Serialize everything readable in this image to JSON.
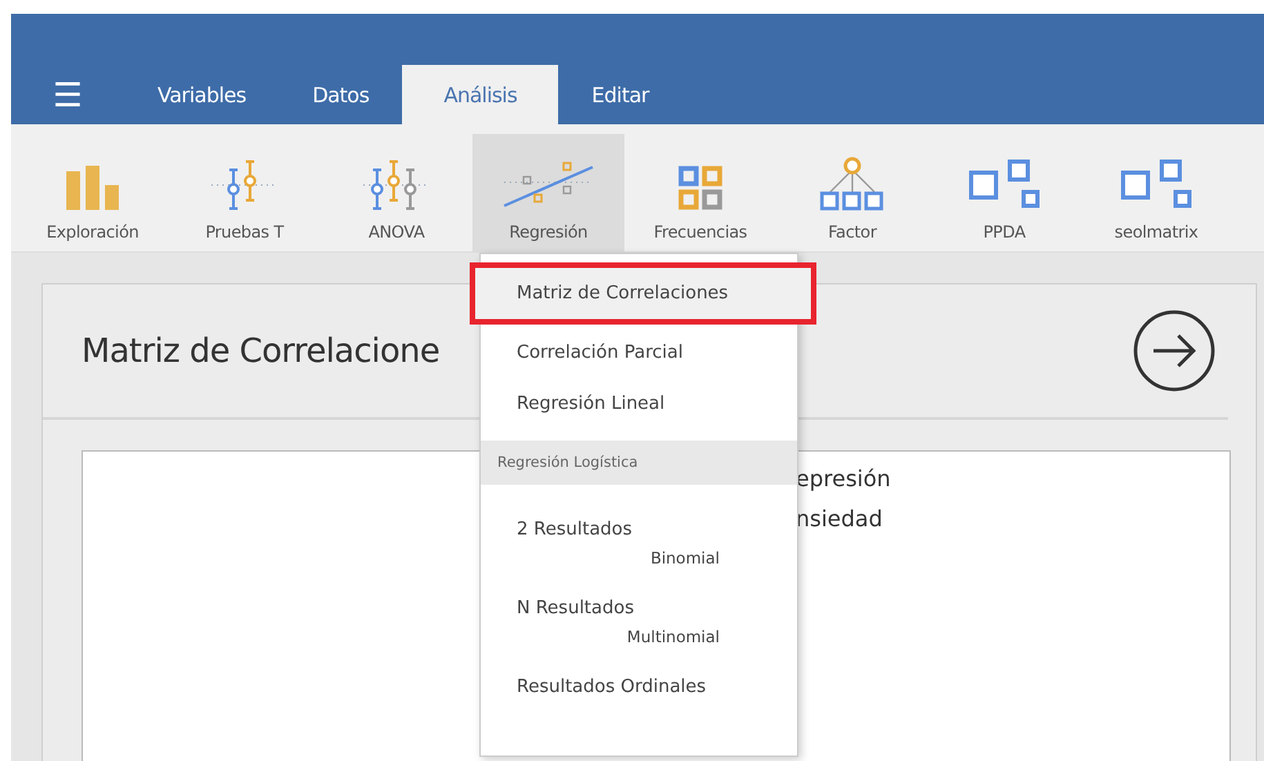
{
  "menu_icon": "☰",
  "tabs": [
    {
      "label": "Variables",
      "selected": false
    },
    {
      "label": "Datos",
      "selected": false
    },
    {
      "label": "Análisis",
      "selected": true
    },
    {
      "label": "Editar",
      "selected": false
    }
  ],
  "ribbon": [
    {
      "label": "Exploración",
      "kind": "bars",
      "selected": false
    },
    {
      "label": "Pruebas T",
      "kind": "ttest",
      "selected": false
    },
    {
      "label": "ANOVA",
      "kind": "anova",
      "selected": false
    },
    {
      "label": "Regresión",
      "kind": "regression",
      "selected": true
    },
    {
      "label": "Frecuencias",
      "kind": "grid",
      "selected": false
    },
    {
      "label": "Factor",
      "kind": "tree",
      "selected": false
    },
    {
      "label": "PPDA",
      "kind": "boxes",
      "selected": false
    },
    {
      "label": "seolmatrix",
      "kind": "boxes",
      "selected": false
    }
  ],
  "panel": {
    "title": "Matriz de Correlacione",
    "variables": [
      "epresión",
      "nsiedad"
    ]
  },
  "dropdown": [
    {
      "kind": "item",
      "label": "Matriz de Correlaciones",
      "selected": true
    },
    {
      "kind": "item",
      "label": "Correlación Parcial",
      "selected": false
    },
    {
      "kind": "item",
      "label": "Regresión Lineal",
      "selected": false
    },
    {
      "kind": "header",
      "label": "Regresión Logística"
    },
    {
      "kind": "item",
      "label": "2 Resultados",
      "sub": "Binomial",
      "selected": false
    },
    {
      "kind": "item",
      "label": "N Resultados",
      "sub": "Multinomial",
      "selected": false
    },
    {
      "kind": "item",
      "label": "Resultados Ordinales",
      "selected": false
    }
  ]
}
